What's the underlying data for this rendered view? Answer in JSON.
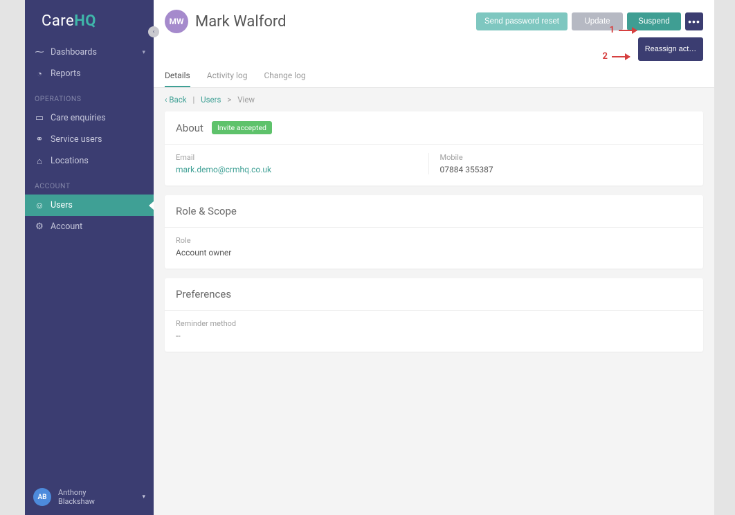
{
  "logo": {
    "care": "Care",
    "hq": "HQ"
  },
  "sidebar": {
    "main": [
      {
        "label": "Dashboards",
        "icon": "pulse",
        "caret": true
      },
      {
        "label": "Reports",
        "icon": "clock"
      }
    ],
    "operations_heading": "OPERATIONS",
    "operations": [
      {
        "label": "Care enquiries",
        "icon": "chat"
      },
      {
        "label": "Service users",
        "icon": "people"
      },
      {
        "label": "Locations",
        "icon": "home"
      }
    ],
    "account_heading": "ACCOUNT",
    "account": [
      {
        "label": "Users",
        "icon": "user",
        "active": true
      },
      {
        "label": "Account",
        "icon": "gear"
      }
    ]
  },
  "footer_user": {
    "initials": "AB",
    "name_first": "Anthony",
    "name_last": "Blackshaw"
  },
  "page": {
    "avatar_initials": "MW",
    "title": "Mark Walford",
    "actions": {
      "reset": "Send password reset",
      "update": "Update",
      "suspend": "Suspend",
      "more": "•••",
      "reassign": "Reassign act…"
    }
  },
  "tabs": [
    {
      "label": "Details",
      "active": true
    },
    {
      "label": "Activity log"
    },
    {
      "label": "Change log"
    }
  ],
  "breadcrumb": {
    "back": "Back",
    "users": "Users",
    "view": "View"
  },
  "about": {
    "title": "About",
    "badge": "Invite accepted",
    "email_label": "Email",
    "email_value": "mark.demo@crmhq.co.uk",
    "mobile_label": "Mobile",
    "mobile_value": "07884 355387"
  },
  "role": {
    "title": "Role & Scope",
    "role_label": "Role",
    "role_value": "Account owner"
  },
  "prefs": {
    "title": "Preferences",
    "reminder_label": "Reminder method",
    "reminder_value": "--"
  },
  "annotations": {
    "one": "1",
    "two": "2"
  }
}
